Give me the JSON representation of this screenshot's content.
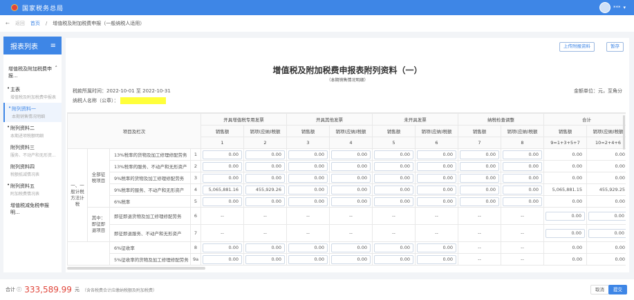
{
  "app": {
    "title": "国家税务总局",
    "user": "***"
  },
  "breadcrumb": {
    "back": "返回",
    "home": "首页",
    "current": "增值税及附加税费申报（一般纳税人适用）"
  },
  "sidebar": {
    "title": "报表列表",
    "group": "增值税及附加税费申报...",
    "items": [
      {
        "label": "主表",
        "sub": "增值税及附加税费申报表",
        "dot": true
      },
      {
        "label": "附列资料一",
        "sub": "本期销售情况明细",
        "dot": true,
        "active": true
      },
      {
        "label": "附列资料二",
        "sub": "本期进项税额明细",
        "dot": true
      },
      {
        "label": "附列资料三",
        "sub": "服务、不动产和无形资...",
        "dot": false
      },
      {
        "label": "附列资料四",
        "sub": "税额抵减情况表",
        "dot": false
      },
      {
        "label": "附列资料五",
        "sub": "附加税费情况表",
        "dot": true
      },
      {
        "label": "增值税减免税申报明...",
        "sub": "",
        "dot": false
      }
    ]
  },
  "toolbar": {
    "upload": "上传附报资料",
    "save_draft": "暂存"
  },
  "form": {
    "title": "增值税及附加税费申报表附列资料（一）",
    "subtitle": "（本期销售情况明细）",
    "period": "税款所属时间：2022-10-01 至 2022-10-31",
    "taxpayer_label": "纳税人名称（公章）：",
    "unit": "金额单位：元，至角分"
  },
  "table": {
    "corner": "项目及栏次",
    "groups": [
      "开具增值税专用发票",
      "开具其他发票",
      "未开具发票",
      "纳税检查调整",
      "合计"
    ],
    "sub": [
      "销售额",
      "销项(应纳)税额"
    ],
    "colnums": [
      "1",
      "2",
      "3",
      "4",
      "5",
      "6",
      "7",
      "8",
      "9=1+3+5+7",
      "10=2+4+6"
    ],
    "section": "一、一般计税方法计税",
    "sub_all": "全部征税项目",
    "sub_jz": "其中：即征即退项目",
    "rows": [
      {
        "label": "13%税率的货物及加工修理修配劳务",
        "no": "1",
        "cells": [
          "0.00",
          "0.00",
          "0.00",
          "0.00",
          "0.00",
          "0.00",
          "0.00",
          "0.00",
          "0.00",
          "0.00"
        ]
      },
      {
        "label": "13%税率的服务、不动产和无形资产",
        "no": "2",
        "cells": [
          "0.00",
          "0.00",
          "0.00",
          "0.00",
          "0.00",
          "0.00",
          "0.00",
          "0.00",
          "0.00",
          "0.00"
        ]
      },
      {
        "label": "9%税率的货物及加工修理修配劳务",
        "no": "3",
        "cells": [
          "0.00",
          "0.00",
          "0.00",
          "0.00",
          "0.00",
          "0.00",
          "0.00",
          "0.00",
          "0.00",
          "0.00"
        ]
      },
      {
        "label": "9%税率的服务、不动产和无形资产",
        "no": "4",
        "cells": [
          "5,065,881.16",
          "455,929.26",
          "0.00",
          "0.00",
          "0.00",
          "0.00",
          "0.00",
          "0.00",
          "5,065,881.15",
          "455,929.25"
        ]
      },
      {
        "label": "6%税率",
        "no": "5",
        "cells": [
          "0.00",
          "0.00",
          "0.00",
          "0.00",
          "0.00",
          "0.00",
          "0.00",
          "0.00",
          "0.00",
          "0.00"
        ]
      },
      {
        "label": "即征即退货物及加工修理修配劳务",
        "no": "6",
        "cells": [
          "--",
          "--",
          "--",
          "--",
          "--",
          "--",
          "--",
          "--",
          "0.00",
          "0.00"
        ]
      },
      {
        "label": "即征即退服务、不动产和无形资产",
        "no": "7",
        "cells": [
          "--",
          "--",
          "--",
          "--",
          "--",
          "--",
          "--",
          "--",
          "0.00",
          "0.00"
        ]
      },
      {
        "label": "6%征收率",
        "no": "8",
        "cells": [
          "0.00",
          "0.00",
          "0.00",
          "0.00",
          "0.00",
          "0.00",
          "--",
          "--",
          "0.00",
          "0.00"
        ]
      },
      {
        "label": "5%征收率的货物及加工修理修配劳务",
        "no": "9a",
        "cells": [
          "0.00",
          "0.00",
          "0.00",
          "0.00",
          "0.00",
          "0.00",
          "--",
          "--",
          "0.00",
          "0.00"
        ]
      }
    ]
  },
  "footer": {
    "label": "合计 ⓘ",
    "total": "333,589.99",
    "currency": "元",
    "note": "（含各税费合计应缴纳税额及附加税费）",
    "cancel": "取消",
    "submit": "提交"
  },
  "colors": {
    "brand": "#3e86e6",
    "total": "#e0453a",
    "highlight": "#ffff3a"
  }
}
